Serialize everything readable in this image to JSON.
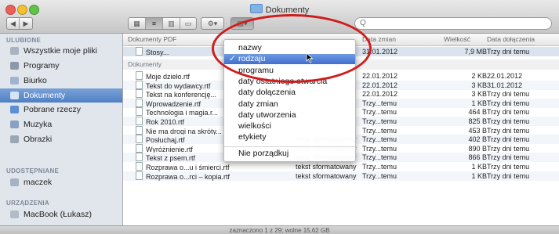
{
  "window": {
    "title": "Dokumenty"
  },
  "toolbar": {
    "search_placeholder": "Q"
  },
  "sidebar": {
    "sections": {
      "favorites": "ULUBIONE",
      "shared": "UDOSTĘPNIANE",
      "devices": "URZĄDZENIA"
    },
    "items": [
      {
        "label": "Wszystkie moje pliki",
        "icon": "all-files-icon"
      },
      {
        "label": "Programy",
        "icon": "applications-icon"
      },
      {
        "label": "Biurko",
        "icon": "desktop-icon"
      },
      {
        "label": "Dokumenty",
        "icon": "documents-icon",
        "selected": true
      },
      {
        "label": "Pobrane rzeczy",
        "icon": "downloads-icon"
      },
      {
        "label": "Muzyka",
        "icon": "music-icon"
      },
      {
        "label": "Obrazki",
        "icon": "pictures-icon"
      }
    ],
    "shared": [
      {
        "label": "maczek",
        "icon": "computer-icon"
      }
    ],
    "devices": [
      {
        "label": "MacBook (Łukasz)",
        "icon": "laptop-icon"
      }
    ]
  },
  "list": {
    "columns": {
      "name": "Dokumenty PDF",
      "modified": "Data zmian",
      "size": "Wielkość",
      "added": "Data dołączenia"
    },
    "pdf_rows": [
      {
        "name": "Stosy...",
        "modified": "31.01.2012",
        "size": "7,9 MB",
        "added": "Trzy dni temu"
      }
    ],
    "group_docs": "Dokumenty",
    "rows": [
      {
        "name": "Moje dzieło.rtf",
        "kind": "",
        "modified": "22.01.2012",
        "size": "2 KB",
        "added": "22.01.2012"
      },
      {
        "name": "Tekst do wydawcy.rtf",
        "kind": "",
        "modified": "22.01.2012",
        "size": "3 KB",
        "added": "31.01.2012"
      },
      {
        "name": "Tekst na konferencję...",
        "kind": "",
        "modified": "22.01.2012",
        "size": "3 KB",
        "added": "Trzy dni temu"
      },
      {
        "name": "Wprowadzenie.rtf",
        "kind": "",
        "modified": "Trzy...temu",
        "size": "1 KB",
        "added": "Trzy dni temu"
      },
      {
        "name": "Technologia i magia.r...",
        "kind": "",
        "modified": "Trzy...temu",
        "size": "464 B",
        "added": "Trzy dni temu"
      },
      {
        "name": "Rok 2010.rtf",
        "kind": "",
        "modified": "Trzy...temu",
        "size": "825 B",
        "added": "Trzy dni temu"
      },
      {
        "name": "Nie ma drogi na skróty...",
        "kind": "",
        "modified": "Trzy...temu",
        "size": "453 B",
        "added": "Trzy dni temu"
      },
      {
        "name": "Posłuchaj.rtf",
        "kind": "tekst sformatowany",
        "modified": "Trzy...temu",
        "size": "402 B",
        "added": "Trzy dni temu"
      },
      {
        "name": "Wyróżnienie.rtf",
        "kind": "tekst sformatowany",
        "modified": "Trzy...temu",
        "size": "890 B",
        "added": "Trzy dni temu"
      },
      {
        "name": "Tekst z psem.rtf",
        "kind": "tekst sformatowany",
        "modified": "Trzy...temu",
        "size": "866 B",
        "added": "Trzy dni temu"
      },
      {
        "name": "Rozprawa o...u i śmierci.rtf",
        "kind": "tekst sformatowany",
        "modified": "Trzy...temu",
        "size": "1 KB",
        "added": "Trzy dni temu"
      },
      {
        "name": "Rozprawa o...rci – kopia.rtf",
        "kind": "tekst sformatowany",
        "modified": "Trzy...temu",
        "size": "1 KB",
        "added": "Trzy dni temu"
      }
    ]
  },
  "menu": {
    "items": [
      "nazwy",
      "rodzaju",
      "programu",
      "daty ostatniego otwarcia",
      "daty dołączenia",
      "daty zmian",
      "daty utworzenia",
      "wielkości",
      "etykiety"
    ],
    "checked_index": 1,
    "checkmark": "✓",
    "bottom_item": "Nie porządkuj"
  },
  "status": {
    "text": "zaznaczono 1 z 29; wolne 15,62 GB"
  },
  "colors": {
    "selection": "#4f7fc3",
    "annotation": "#d11c1c"
  }
}
